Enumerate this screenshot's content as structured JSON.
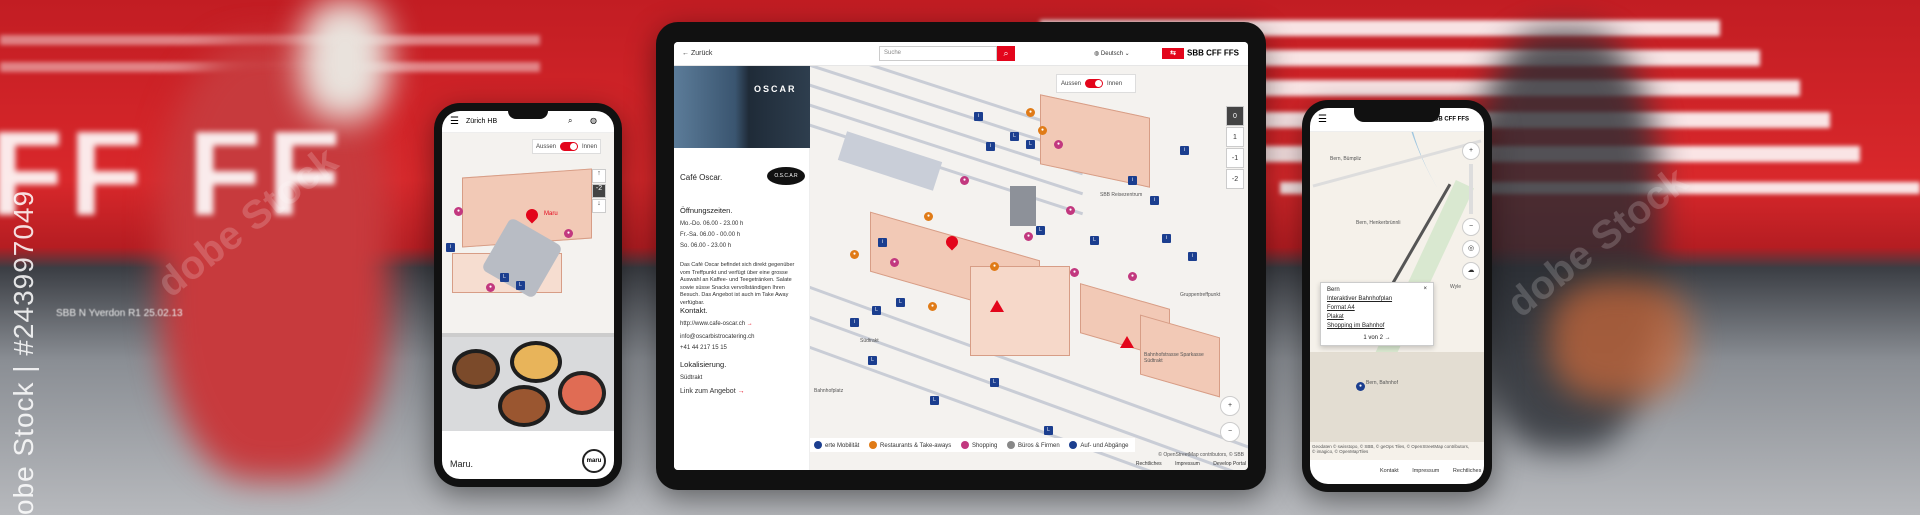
{
  "background": {
    "train_letters": "FF FF",
    "train_text": "SBB   N    Yverdon    R1 25.02.13",
    "watermark_side": "obe Stock | #243997049",
    "watermark": "dobe Stock"
  },
  "tablet": {
    "back": "Zurück",
    "search_placeholder": "Suche",
    "language": "Deutsch",
    "brand": "SBB CFF FFS",
    "toggle_left": "Aussen",
    "toggle_right": "Innen",
    "floor_levels": [
      "0",
      "1",
      "-1",
      "-2"
    ],
    "place": {
      "name": "Café Oscar.",
      "photo_sign": "OSCAR",
      "logo_text": "O.S.C.A.R",
      "hours_title": "Öffnungszeiten.",
      "hours": [
        "Mo.-Do. 06.00 - 23.00 h",
        "Fr.-Sa. 06.00 - 00.00 h",
        "So. 06.00 - 23.00 h"
      ],
      "description": "Das Café Oscar befindet sich direkt gegenüber vom Treffpunkt und verfügt über eine grosse Auswahl an Kaffee- und Teegetränken. Salate sowie süsse Snacks vervollständigen Ihren Besuch. Das Angebot ist auch im Take Away verfügbar.",
      "contact_title": "Kontakt.",
      "website": "http://www.cafe-oscar.ch",
      "email": "info@oscarbistrocatering.ch",
      "phone": "+41 44 217 15 15",
      "location_title": "Lokalisierung.",
      "location": "Südtrakt",
      "offer_link": "Link zum Angebot"
    },
    "map_labels": {
      "sbb_reisezentrum": "SBB Reisezentrum",
      "gruppentreffpunkt": "Gruppentreffpunkt",
      "gepaeck": "Bahnhofstrasse Sparkasse Südtrakt",
      "bahnhofplatz": "Bahnhofplatz",
      "suedtrakt": "Südtrakt"
    },
    "legend": [
      "erte Mobilität",
      "Restaurants & Take-aways",
      "Shopping",
      "Büros & Firmen",
      "Auf- und Abgänge"
    ],
    "legend_colors": [
      "#1b3e8f",
      "#e07b17",
      "#c2387f",
      "#888888",
      "#1b3e8f"
    ],
    "attribution": "© OpenStreetMap contributors, © SBB",
    "footer": [
      "Rechtliches",
      "Impressum",
      "Develop Portal"
    ]
  },
  "phone_left": {
    "title": "Zürich HB",
    "toggle_left": "Aussen",
    "toggle_right": "Innen",
    "level": "-2",
    "map_pin_label": "Maru",
    "place_name": "Maru.",
    "logo_text": "maru"
  },
  "phone_right": {
    "brand": "SBB CFF FFS",
    "labels": [
      "Bern, Bümpliz",
      "Bern, Henkerbrünnli",
      "Bern, Bahnhof",
      "Bern"
    ],
    "wylerfeld": "Wyle",
    "popup": {
      "title": "Bern",
      "links": [
        "Interaktiver Bahnhofplan",
        "Format A4",
        "Plakat",
        "Shopping im Bahnhof"
      ],
      "pager": "1 von 2"
    },
    "attribution": "Geodaten © swisstopo, © SBB, © geOps Tiles, © OpenStreetMap contributors, © imagico, © OpenMapTiles",
    "footer": [
      "Kontakt",
      "Impressum",
      "Rechtliches"
    ]
  }
}
